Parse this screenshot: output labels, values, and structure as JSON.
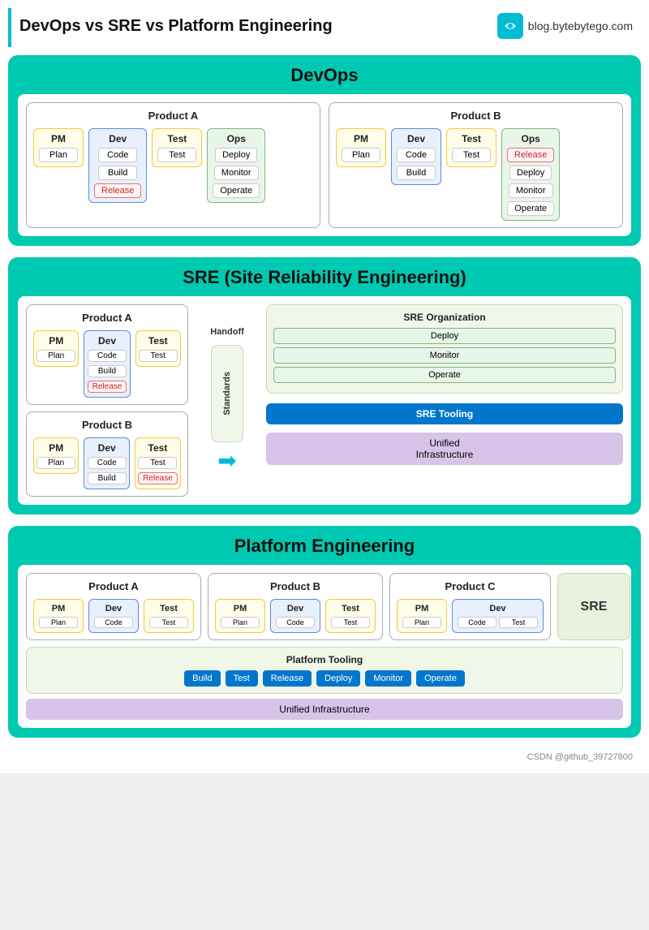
{
  "header": {
    "title": "DevOps vs SRE vs Platform Engineering",
    "logo_text": "blog.bytebytego.com",
    "logo_icon": "B"
  },
  "devops": {
    "title": "DevOps",
    "product_a": {
      "title": "Product A",
      "pm": {
        "label": "PM",
        "tasks": [
          "Plan"
        ]
      },
      "dev": {
        "label": "Dev",
        "tasks": [
          "Code",
          "Build",
          "Release"
        ]
      },
      "test": {
        "label": "Test",
        "tasks": [
          "Test"
        ]
      },
      "ops": {
        "label": "Ops",
        "tasks": [
          "Deploy",
          "Monitor",
          "Operate"
        ]
      }
    },
    "product_b": {
      "title": "Product B",
      "pm": {
        "label": "PM",
        "tasks": [
          "Plan"
        ]
      },
      "dev": {
        "label": "Dev",
        "tasks": [
          "Code",
          "Build"
        ]
      },
      "test": {
        "label": "Test",
        "tasks": [
          "Test"
        ]
      },
      "ops": {
        "label": "Ops",
        "tasks": [
          "Release",
          "Deploy",
          "Monitor",
          "Operate"
        ]
      }
    }
  },
  "sre": {
    "title": "SRE (Site Reliability Engineering)",
    "product_a": {
      "title": "Product A",
      "pm": {
        "label": "PM",
        "tasks": [
          "Plan"
        ]
      },
      "dev": {
        "label": "Dev",
        "tasks": [
          "Code",
          "Build",
          "Release"
        ]
      },
      "test": {
        "label": "Test",
        "tasks": [
          "Test"
        ]
      }
    },
    "product_b": {
      "title": "Product B",
      "pm": {
        "label": "PM",
        "tasks": [
          "Plan"
        ]
      },
      "dev": {
        "label": "Dev",
        "tasks": [
          "Code",
          "Build"
        ]
      },
      "test": {
        "label": "Test",
        "tasks": [
          "Test",
          "Release"
        ]
      }
    },
    "handoff": "Handoff",
    "standards": "Standards",
    "sre_org": {
      "title": "SRE Organization",
      "tasks": [
        "Deploy",
        "Monitor",
        "Operate"
      ]
    },
    "tooling": "SRE Tooling",
    "infra": "Unified Infrastructure"
  },
  "platform": {
    "title": "Platform Engineering",
    "product_a": {
      "title": "Product A",
      "pm": "PM",
      "dev": "Dev",
      "test": "Test",
      "pm_task": "Plan",
      "dev_task": "Code",
      "test_task": "Test"
    },
    "product_b": {
      "title": "Product B",
      "pm": "PM",
      "dev": "Dev",
      "test": "Test",
      "pm_task": "Plan",
      "dev_task": "Code",
      "test_task": "Test"
    },
    "product_c": {
      "title": "Product C",
      "pm": "PM",
      "dev": "Dev",
      "pm_task": "Plan",
      "dev_tasks": [
        "Code",
        "Test"
      ]
    },
    "sre_label": "SRE",
    "tooling_title": "Platform Tooling",
    "tools": [
      "Build",
      "Test",
      "Release",
      "Deploy",
      "Monitor",
      "Operate"
    ],
    "infra": "Unified Infrastructure"
  },
  "footer": "CSDN @github_39727800"
}
